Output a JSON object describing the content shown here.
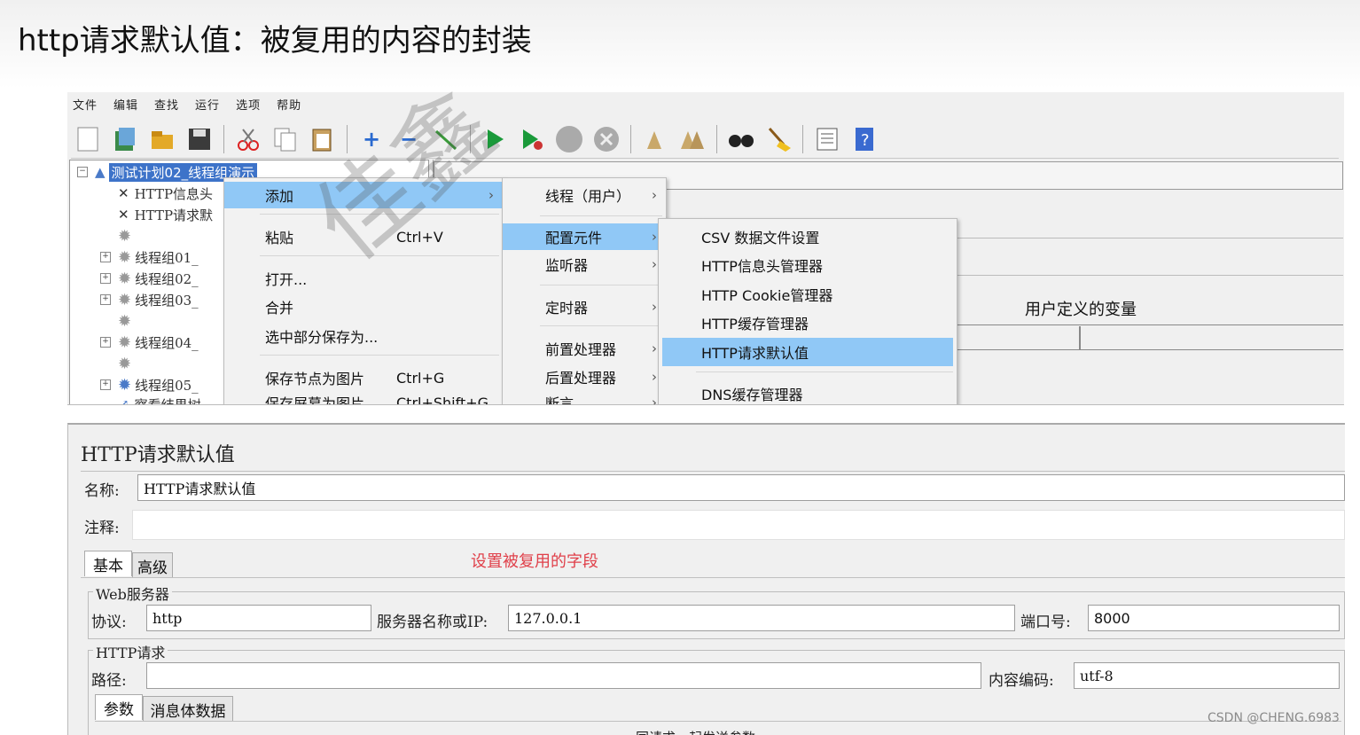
{
  "slide": {
    "title": "http请求默认值：被复用的内容的封装"
  },
  "jmeter": {
    "menubar": [
      "文件",
      "编辑",
      "查找",
      "运行",
      "选项",
      "帮助"
    ],
    "toolbar_icons": [
      "new-icon",
      "templates-icon",
      "open-icon",
      "save-icon",
      "cut-icon",
      "copy-icon",
      "paste-icon",
      "expand-icon",
      "collapse-icon",
      "toggle-icon",
      "start-icon",
      "start-no-timers-icon",
      "stop-icon",
      "shutdown-icon",
      "clear-icon",
      "clear-all-icon",
      "search-icon",
      "reset-search-icon",
      "function-helper-icon",
      "help-icon"
    ],
    "tree": {
      "root": "测试计划02_线程组演示",
      "items": [
        {
          "label": "HTTP信息头",
          "icon": "wrench-icon"
        },
        {
          "label": "HTTP请求默",
          "icon": "wrench-icon"
        },
        {
          "label": "",
          "icon": "gear-icon"
        },
        {
          "label": "线程组01_",
          "icon": "gear-icon"
        },
        {
          "label": "线程组02_",
          "icon": "gear-icon"
        },
        {
          "label": "线程组03_",
          "icon": "gear-icon"
        },
        {
          "label": "",
          "icon": "gear-icon"
        },
        {
          "label": "线程组04_",
          "icon": "gear-icon"
        },
        {
          "label": "",
          "icon": "gear-icon"
        },
        {
          "label": "线程组05_",
          "icon": "gear-icon"
        },
        {
          "label": "察看结果树",
          "icon": "listener-icon"
        }
      ]
    },
    "context_menu": {
      "items": [
        {
          "label": "添加",
          "shortcut": "",
          "submenu": true,
          "highlighted": true
        },
        {
          "label": "粘贴",
          "shortcut": "Ctrl+V"
        },
        {
          "label": "打开...",
          "shortcut": ""
        },
        {
          "label": "合并",
          "shortcut": ""
        },
        {
          "label": "选中部分保存为...",
          "shortcut": ""
        },
        {
          "label": "保存节点为图片",
          "shortcut": "Ctrl+G"
        },
        {
          "label": "保存屏幕为图片",
          "shortcut": "Ctrl+Shift+G"
        }
      ]
    },
    "add_submenu": {
      "items": [
        {
          "label": "线程（用户）"
        },
        {
          "label": "配置元件",
          "highlighted": true
        },
        {
          "label": "监听器"
        },
        {
          "label": "定时器"
        },
        {
          "label": "前置处理器"
        },
        {
          "label": "后置处理器"
        },
        {
          "label": "断言"
        }
      ]
    },
    "config_submenu": {
      "items": [
        {
          "label": "CSV 数据文件设置"
        },
        {
          "label": "HTTP信息头管理器"
        },
        {
          "label": "HTTP Cookie管理器"
        },
        {
          "label": "HTTP缓存管理器"
        },
        {
          "label": "HTTP请求默认值",
          "highlighted": true
        },
        {
          "label": "DNS缓存管理器"
        }
      ]
    },
    "right_pane": {
      "user_vars_label": "用户定义的变量"
    }
  },
  "panel": {
    "title": "HTTP请求默认值",
    "name_label": "名称:",
    "name_value": "HTTP请求默认值",
    "comment_label": "注释:",
    "comment_value": "",
    "tabs": [
      "基本",
      "高级"
    ],
    "annotation": "设置被复用的字段",
    "web_server": {
      "legend": "Web服务器",
      "protocol_label": "协议:",
      "protocol_value": "http",
      "server_label": "服务器名称或IP:",
      "server_value": "127.0.0.1",
      "port_label": "端口号:",
      "port_value": "8000"
    },
    "http_request": {
      "legend": "HTTP请求",
      "path_label": "路径:",
      "path_value": "",
      "encoding_label": "内容编码:",
      "encoding_value": "utf-8",
      "subtabs": [
        "参数",
        "消息体数据"
      ],
      "bottom_text": "同请求一起发送参数"
    }
  },
  "footer": {
    "watermark": "CSDN @CHENG.6983"
  },
  "colors": {
    "highlight": "#90c8f6",
    "tree_selection": "#3d73c9",
    "annotation": "#e0404a"
  }
}
